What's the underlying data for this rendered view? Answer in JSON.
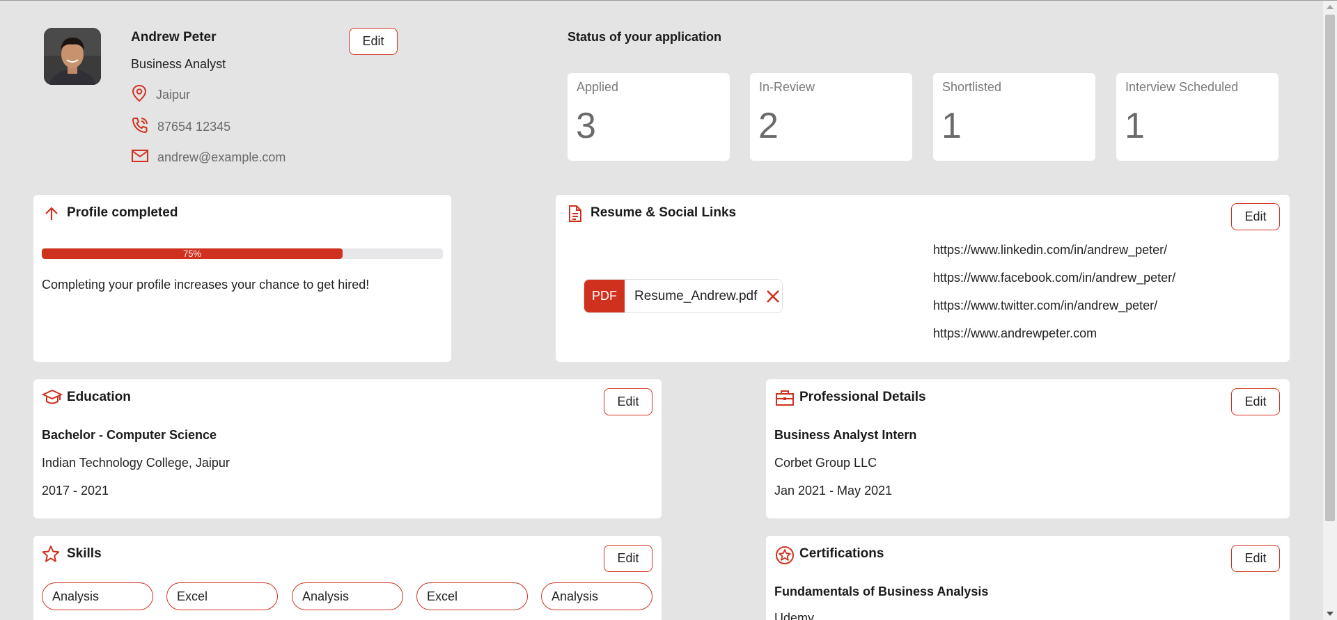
{
  "profile": {
    "name": "Andrew Peter",
    "role": "Business Analyst",
    "location": "Jaipur",
    "phone": "87654 12345",
    "email": "andrew@example.com",
    "edit_label": "Edit"
  },
  "status": {
    "title": "Status of your application",
    "items": [
      {
        "label": "Applied",
        "count": "3"
      },
      {
        "label": "In-Review",
        "count": "2"
      },
      {
        "label": "Shortlisted",
        "count": "1"
      },
      {
        "label": "Interview Scheduled",
        "count": "1"
      }
    ]
  },
  "profile_completion": {
    "title": "Profile completed",
    "percent_label": "75%",
    "percent": 75,
    "message": "Completing your profile increases your chance to get hired!"
  },
  "resume": {
    "title": "Resume & Social Links",
    "edit_label": "Edit",
    "file_badge": "PDF",
    "file_name": "Resume_Andrew.pdf",
    "links": [
      "https://www.linkedin.com/in/andrew_peter/",
      "https://www.facebook.com/in/andrew_peter/",
      "https://www.twitter.com/in/andrew_peter/",
      "https://www.andrewpeter.com"
    ]
  },
  "education": {
    "title": "Education",
    "edit_label": "Edit",
    "degree": "Bachelor - Computer Science",
    "institution": "Indian Technology College, Jaipur",
    "years": "2017 - 2021"
  },
  "professional": {
    "title": "Professional Details",
    "edit_label": "Edit",
    "position": "Business Analyst Intern",
    "company": "Corbet Group LLC",
    "period": "Jan 2021 - May 2021"
  },
  "skills": {
    "title": "Skills",
    "edit_label": "Edit",
    "items": [
      "Analysis",
      "Excel",
      "Analysis",
      "Excel",
      "Analysis"
    ]
  },
  "certifications": {
    "title": "Certifications",
    "edit_label": "Edit",
    "name": "Fundamentals of Business Analysis",
    "issuer": "Udemy"
  },
  "colors": {
    "accent": "#d0311f",
    "background": "#e4e4e4",
    "card": "#ffffff"
  },
  "icons": [
    "location-pin-icon",
    "phone-icon",
    "mail-icon",
    "arrow-up-icon",
    "document-icon",
    "graduation-cap-icon",
    "briefcase-icon",
    "star-icon",
    "award-icon",
    "close-icon"
  ]
}
